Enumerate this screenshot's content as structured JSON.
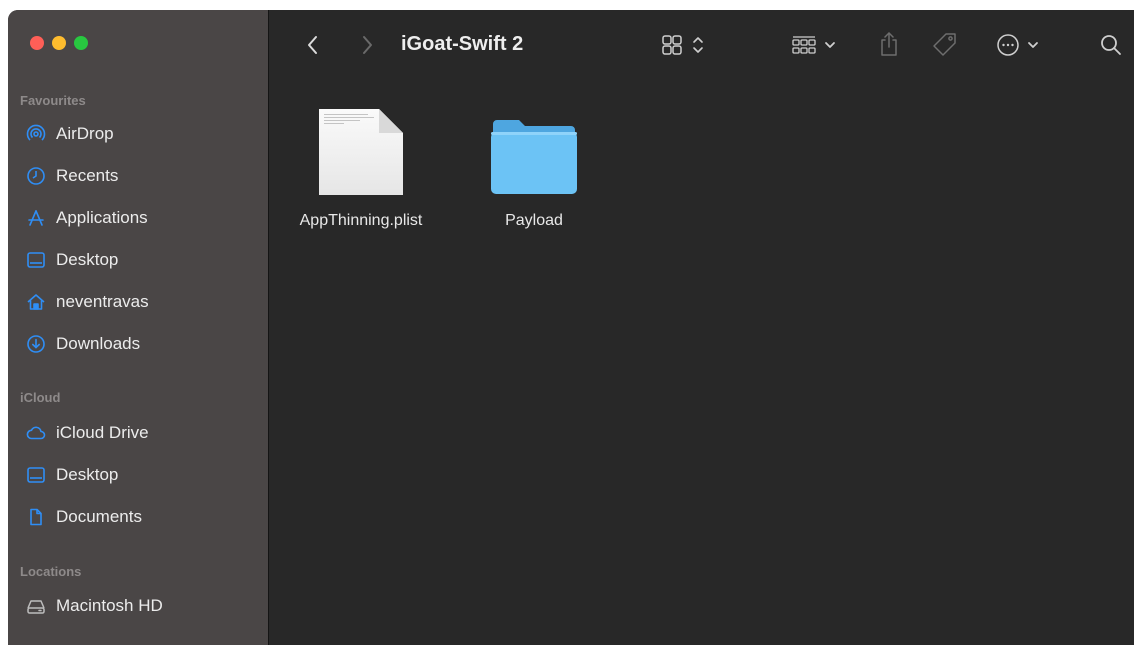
{
  "window": {
    "title": "iGoat-Swift 2"
  },
  "sidebar": {
    "favourites_title": "Favourites",
    "favourites": [
      {
        "label": "AirDrop",
        "icon": "airdrop-icon"
      },
      {
        "label": "Recents",
        "icon": "clock-icon"
      },
      {
        "label": "Applications",
        "icon": "applications-icon"
      },
      {
        "label": "Desktop",
        "icon": "desktop-icon"
      },
      {
        "label": "neventravas",
        "icon": "home-icon"
      },
      {
        "label": "Downloads",
        "icon": "download-icon"
      }
    ],
    "icloud_title": "iCloud",
    "icloud": [
      {
        "label": "iCloud Drive",
        "icon": "cloud-icon"
      },
      {
        "label": "Desktop",
        "icon": "desktop-icon"
      },
      {
        "label": "Documents",
        "icon": "document-icon"
      }
    ],
    "locations_title": "Locations",
    "locations": [
      {
        "label": "Macintosh HD",
        "icon": "hard-drive-icon"
      }
    ]
  },
  "files": [
    {
      "name": "AppThinning.plist",
      "icon": "plist-file-icon"
    },
    {
      "name": "Payload",
      "icon": "folder-icon"
    }
  ],
  "colors": {
    "accent": "#2f8ef5",
    "sidebar_bg": "#4a4646",
    "content_bg": "#282828",
    "folder": "#6cc3f5"
  }
}
